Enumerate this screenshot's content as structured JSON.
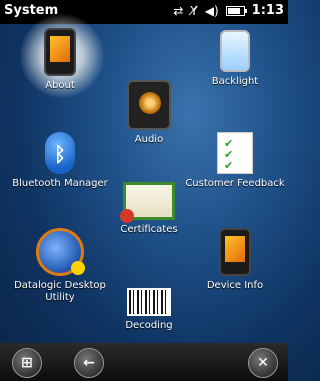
{
  "statusbar": {
    "title": "System",
    "time": "1:13",
    "icons": [
      "sync-icon",
      "no-signal-icon",
      "volume-icon",
      "battery-icon"
    ]
  },
  "items": [
    {
      "id": "about",
      "label": "About",
      "icon": "phone-icon"
    },
    {
      "id": "audio",
      "label": "Audio",
      "icon": "speaker-icon"
    },
    {
      "id": "backlight",
      "label": "Backlight",
      "icon": "backlight-icon"
    },
    {
      "id": "bluetooth",
      "label": "Bluetooth Manager",
      "icon": "bluetooth-icon"
    },
    {
      "id": "certificates",
      "label": "Certificates",
      "icon": "certificate-icon"
    },
    {
      "id": "feedback",
      "label": "Customer Feedback",
      "icon": "checklist-icon"
    },
    {
      "id": "datalogic",
      "label": "Datalogic Desktop Utility",
      "icon": "datalogic-icon"
    },
    {
      "id": "decoding",
      "label": "Decoding",
      "icon": "barcode-icon"
    },
    {
      "id": "deviceinfo",
      "label": "Device Info",
      "icon": "device-info-icon"
    }
  ],
  "bottombar": {
    "buttons": [
      "windows-start-icon",
      "back-arrow-icon",
      "close-icon"
    ]
  }
}
